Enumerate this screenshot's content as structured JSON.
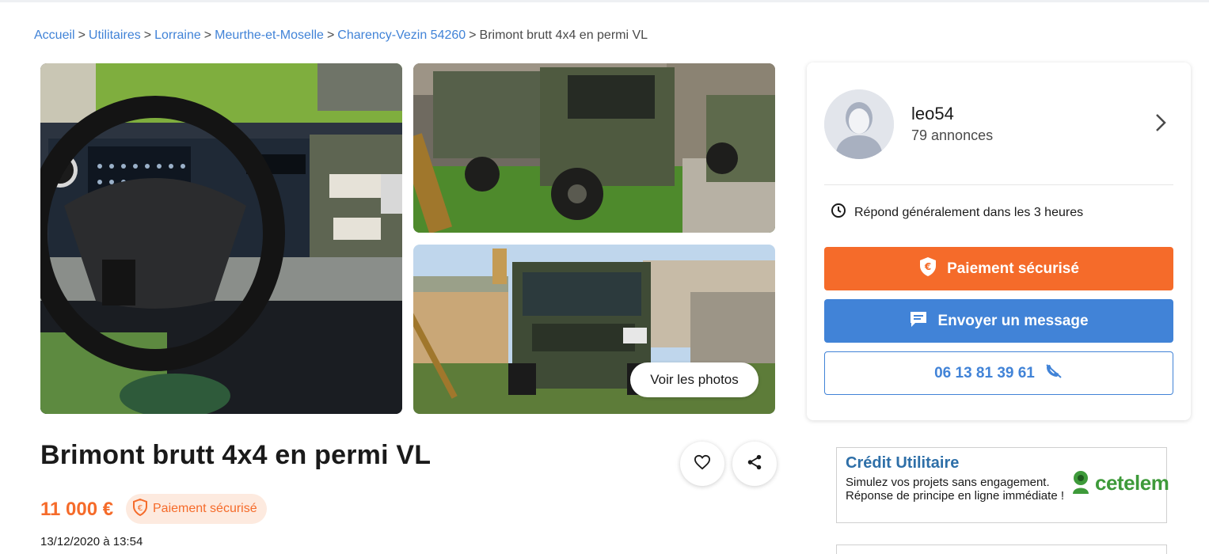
{
  "breadcrumb": {
    "items": [
      "Accueil",
      "Utilitaires",
      "Lorraine",
      "Meurthe-et-Moselle",
      "Charency-Vezin 54260"
    ],
    "current": "Brimont brutt 4x4 en permi VL",
    "separator": ">"
  },
  "gallery": {
    "see_photos_label": "Voir les photos"
  },
  "listing": {
    "title": "Brimont brutt 4x4 en permi VL",
    "price": "11 000 €",
    "secure_badge_label": "Paiement sécurisé",
    "date": "13/12/2020 à 13:54"
  },
  "seller": {
    "name": "leo54",
    "ads_count": "79 annonces",
    "response_time": "Répond généralement dans les 3 heures"
  },
  "actions": {
    "pay_label": "Paiement sécurisé",
    "message_label": "Envoyer un message",
    "phone_label": "06 13 81 39 61"
  },
  "credit_ad": {
    "title": "Crédit Utilitaire",
    "text": "Simulez vos projets sans engagement. Réponse de principe en ligne immédiate !",
    "brand": "cetelem"
  },
  "colors": {
    "accent_orange": "#f56b2a",
    "link_blue": "#4183d7",
    "credit_blue": "#2e6fa8",
    "cetelem_green": "#3e9a3a"
  },
  "icons": {
    "heart": "heart-icon",
    "share": "share-icon",
    "clock": "clock-icon",
    "shield": "shield-euro-icon",
    "message": "message-icon",
    "phone_hidden": "phone-hidden-icon",
    "chevron": "chevron-right-icon"
  }
}
